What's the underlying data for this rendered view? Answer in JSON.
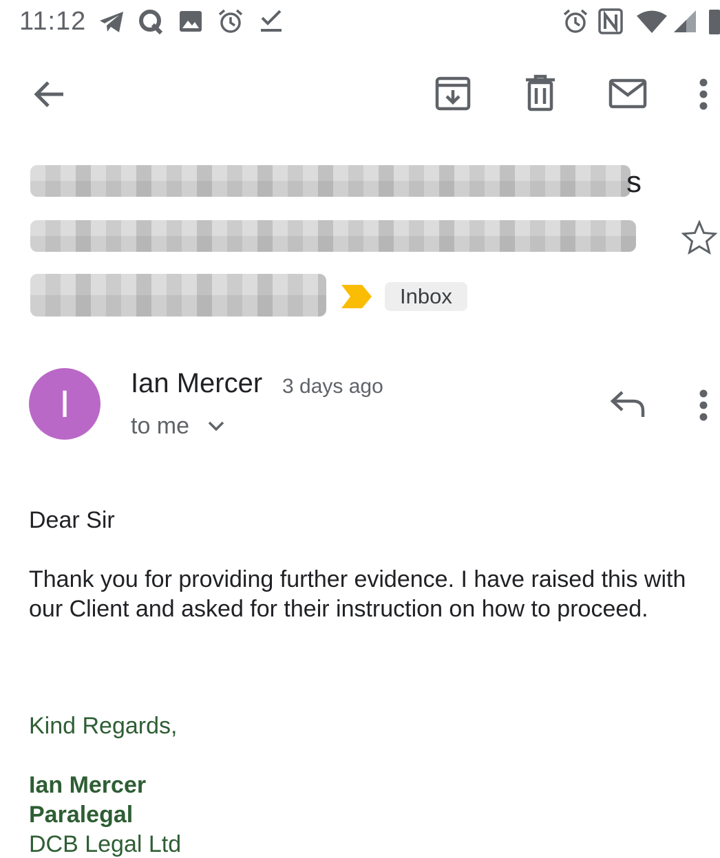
{
  "status_bar": {
    "time": "11:12",
    "left_icons": [
      "telegram-icon",
      "q-icon",
      "image-icon",
      "alarm-icon",
      "check-icon"
    ],
    "right_icons": [
      "alarm-icon",
      "nfc-icon",
      "wifi-icon",
      "signal-icon",
      "battery-icon"
    ]
  },
  "toolbar": {
    "actions": [
      "back",
      "archive",
      "delete",
      "mark-unread",
      "more"
    ]
  },
  "subject": {
    "visible_suffix": "s",
    "label": "Inbox"
  },
  "message": {
    "avatar_letter": "I",
    "avatar_color": "#ba68c8",
    "sender": "Ian Mercer",
    "time_ago": "3 days ago",
    "recipient": "to me",
    "greeting": "Dear Sir",
    "paragraph": "Thank you for providing further evidence. I have raised this with our Client and asked for their instruction on how to proceed.",
    "closing": "Kind Regards,",
    "signature_name": "Ian Mercer",
    "signature_title": "Paralegal",
    "signature_company": "DCB Legal Ltd"
  },
  "colors": {
    "signature": "#2e5e34",
    "icon_gray": "#5f6368",
    "importance_marker": "#fbbc04"
  }
}
